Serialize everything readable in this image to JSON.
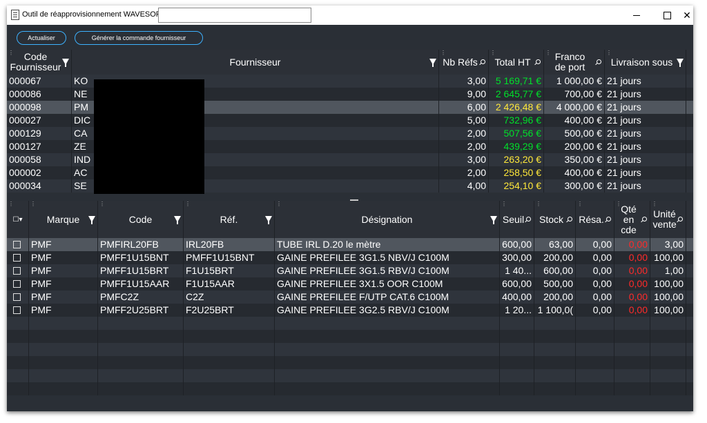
{
  "window": {
    "title": "Outil de réapprovisionnement WAVESOFT -",
    "close_glyph": "✕"
  },
  "toolbar": {
    "refresh_label": "Actualiser",
    "generate_label": "Générer la commande fournisseur"
  },
  "suppliers": {
    "columns": {
      "code": "Code Fournisseur",
      "name": "Fournisseur",
      "nb_refs": "Nb Réfs",
      "total_ht": "Total HT",
      "franco": "Franco de port",
      "delivery": "Livraison sous"
    },
    "rows": [
      {
        "code": "000067",
        "name": "KO",
        "nb": "3,00",
        "total": "5 169,71 €",
        "total_color": "green",
        "franco": "1 000,00 €",
        "delivery": "21 jours"
      },
      {
        "code": "000086",
        "name": "NE",
        "nb": "9,00",
        "total": "2 645,77 €",
        "total_color": "green",
        "franco": "700,00 €",
        "delivery": "21 jours"
      },
      {
        "code": "000098",
        "name": "PM",
        "nb": "6,00",
        "total": "2 426,48 €",
        "total_color": "yellow",
        "franco": "4 000,00 €",
        "delivery": "21 jours",
        "selected": true
      },
      {
        "code": "000027",
        "name": "DIC",
        "nb": "5,00",
        "total": "732,96 €",
        "total_color": "green",
        "franco": "400,00 €",
        "delivery": "21 jours"
      },
      {
        "code": "000129",
        "name": "CA",
        "nb": "2,00",
        "total": "507,56 €",
        "total_color": "green",
        "franco": "500,00 €",
        "delivery": "21 jours"
      },
      {
        "code": "000127",
        "name": "ZE",
        "nb": "2,00",
        "total": "439,29 €",
        "total_color": "green",
        "franco": "200,00 €",
        "delivery": "21 jours"
      },
      {
        "code": "000058",
        "name": "IND",
        "nb": "3,00",
        "total": "263,20 €",
        "total_color": "yellow",
        "franco": "350,00 €",
        "delivery": "21 jours"
      },
      {
        "code": "000002",
        "name": "AC",
        "nb": "2,00",
        "total": "258,50 €",
        "total_color": "yellow",
        "franco": "400,00 €",
        "delivery": "21 jours"
      },
      {
        "code": "000034",
        "name": "SE",
        "nb": "4,00",
        "total": "254,10 €",
        "total_color": "yellow",
        "franco": "300,00 €",
        "delivery": "21 jours"
      }
    ]
  },
  "items": {
    "columns": {
      "check": "☐▾",
      "brand": "Marque",
      "code": "Code",
      "ref": "Réf.",
      "designation": "Désignation",
      "threshold": "Seuil",
      "stock": "Stock",
      "reserved": "Résa.",
      "qty_ordered": "Qté en cde",
      "unit_sale": "Unité vente"
    },
    "rows": [
      {
        "brand": "PMF",
        "code": "PMFIRL20FB",
        "ref": "IRL20FB",
        "designation": "TUBE IRL D.20 le mètre",
        "threshold": "600,00",
        "stock": "63,00",
        "reserved": "0,00",
        "qty": "0,00",
        "unit": "3,00",
        "selected": true
      },
      {
        "brand": "PMF",
        "code": "PMFF1U15BNT",
        "ref": "PMFF1U15BNT",
        "designation": " GAINE PREFILEE 3G1.5 NBV/J C100M",
        "threshold": "300,00",
        "stock": "200,00",
        "reserved": "0,00",
        "qty": "0,00",
        "unit": "100,00"
      },
      {
        "brand": "PMF",
        "code": "PMFF1U15BRT",
        "ref": "F1U15BRT",
        "designation": " GAINE PREFILEE 3G1.5 RBV/J C100M",
        "threshold": "1 40...",
        "stock": "600,00",
        "reserved": "0,00",
        "qty": "0,00",
        "unit": "1,00"
      },
      {
        "brand": "PMF",
        "code": "PMFF1U15AAR",
        "ref": "F1U15AAR",
        "designation": "GAINE PREFILEE 3X1.5 OOR C100M",
        "threshold": "600,00",
        "stock": "500,00",
        "reserved": "0,00",
        "qty": "0,00",
        "unit": "100,00"
      },
      {
        "brand": "PMF",
        "code": "PMFC2Z",
        "ref": "C2Z",
        "designation": " GAINE PREFILEE F/UTP CAT.6 C100M",
        "threshold": "400,00",
        "stock": "200,00",
        "reserved": "0,00",
        "qty": "0,00",
        "unit": "100,00"
      },
      {
        "brand": "PMF",
        "code": "PMFF2U25BRT",
        "ref": "F2U25BRT",
        "designation": " GAINE PREFILEE 3G2.5 RBV/J C100M",
        "threshold": "1 20...",
        "stock": "1 100,0(",
        "reserved": "0,00",
        "qty": "0,00",
        "unit": "100,00"
      }
    ]
  }
}
